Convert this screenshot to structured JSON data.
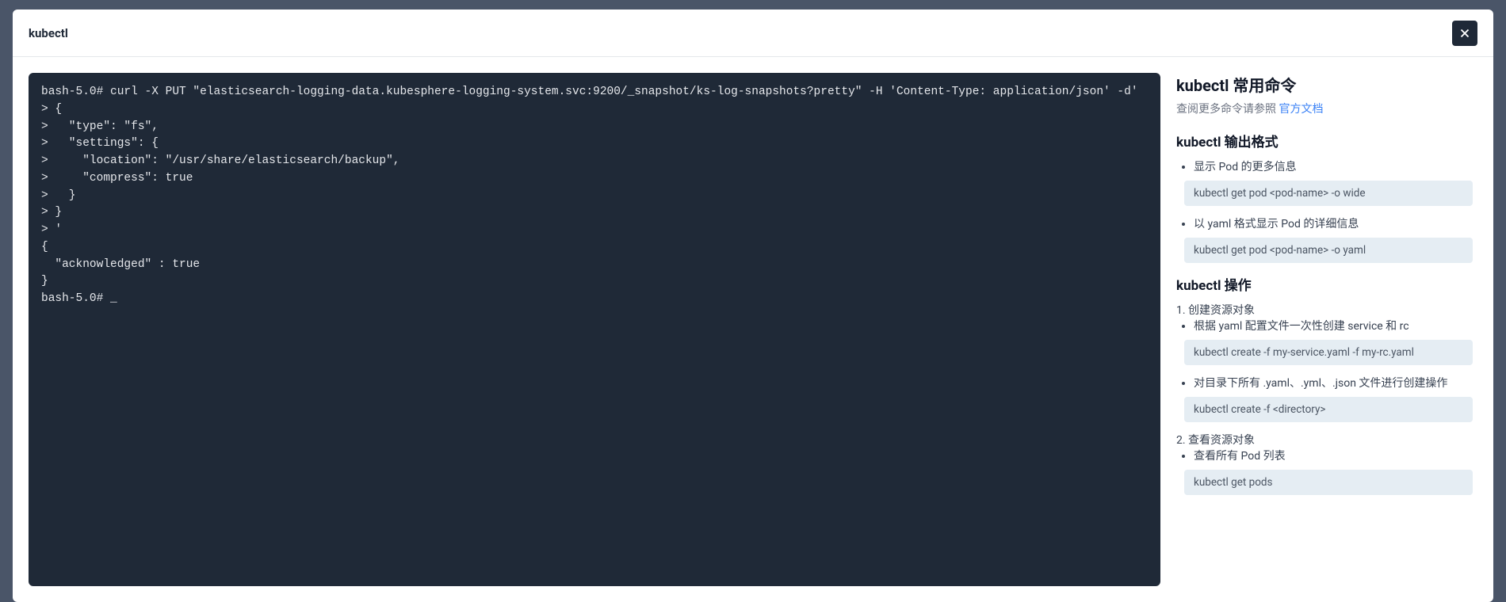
{
  "header": {
    "title": "kubectl"
  },
  "terminal": {
    "content": "bash-5.0# curl -X PUT \"elasticsearch-logging-data.kubesphere-logging-system.svc:9200/_snapshot/ks-log-snapshots?pretty\" -H 'Content-Type: application/json' -d'\n> {\n>   \"type\": \"fs\",\n>   \"settings\": {\n>     \"location\": \"/usr/share/elasticsearch/backup\",\n>     \"compress\": true\n>   }\n> }\n> '\n{\n  \"acknowledged\" : true\n}\nbash-5.0# "
  },
  "help": {
    "title": "kubectl 常用命令",
    "subtitle_prefix": "查阅更多命令请参照 ",
    "subtitle_link": "官方文档",
    "sections": [
      {
        "heading": "kubectl 输出格式",
        "items": [
          {
            "label": "显示 Pod 的更多信息",
            "code": "kubectl get pod <pod-name> -o wide"
          },
          {
            "label": "以 yaml 格式显示 Pod 的详细信息",
            "code": "kubectl get pod <pod-name> -o yaml"
          }
        ]
      },
      {
        "heading": "kubectl 操作",
        "ordered": [
          {
            "num": "1.",
            "title": "创建资源对象",
            "items": [
              {
                "label": "根据 yaml 配置文件一次性创建 service 和 rc",
                "code": "kubectl create -f my-service.yaml -f my-rc.yaml"
              },
              {
                "label": "对目录下所有 .yaml、.yml、.json 文件进行创建操作",
                "code": "kubectl create -f <directory>"
              }
            ]
          },
          {
            "num": "2.",
            "title": "查看资源对象",
            "items": [
              {
                "label": "查看所有 Pod 列表",
                "code": "kubectl get pods"
              }
            ]
          }
        ]
      }
    ]
  }
}
